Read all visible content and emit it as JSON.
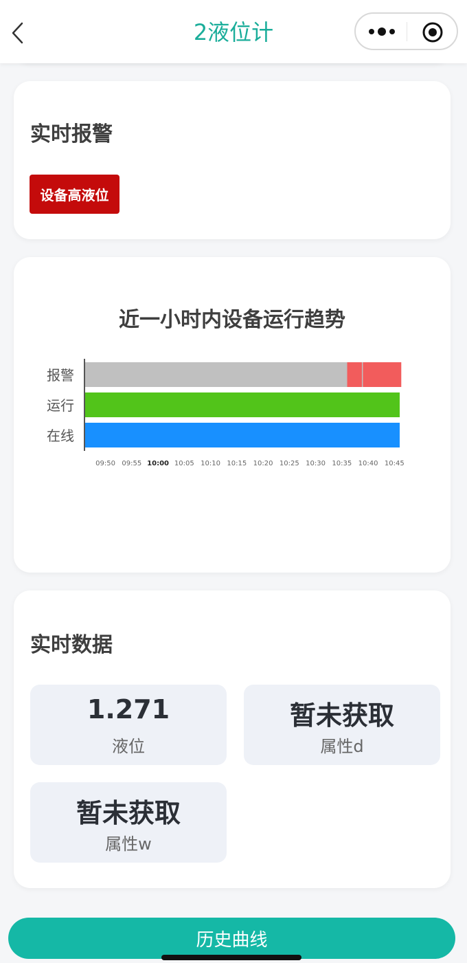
{
  "nav": {
    "title": "2液位计",
    "back_icon": "chevron-left-icon",
    "more_icon": "more-dots-icon",
    "close_icon": "target-circle-icon"
  },
  "alarm_section": {
    "title": "实时报警",
    "badges": [
      "设备高液位"
    ],
    "badge_color": "#c40b0b"
  },
  "trend_section": {
    "chart_data": {
      "type": "timeline",
      "title": "近一小时内设备运行趋势",
      "categories": [
        "报警",
        "运行",
        "在线"
      ],
      "x_ticks": [
        "09:50",
        "09:55",
        "10:00",
        "10:05",
        "10:10",
        "10:15",
        "10:20",
        "10:25",
        "10:30",
        "10:35",
        "10:40",
        "10:45"
      ],
      "bold_tick": "10:00",
      "x_range": [
        "09:46",
        "10:46"
      ],
      "colors": {
        "报警_base": "#c0c0c0",
        "报警_event": "#f25c5c",
        "运行": "#52c41a",
        "在线": "#1890ff"
      },
      "series": [
        {
          "name": "报警",
          "base_state": "normal",
          "events": [
            {
              "time": "10:36",
              "duration_min": 0.2
            },
            {
              "time": "10:37",
              "duration_min": 0.3
            },
            {
              "time": "10:39",
              "duration_min": 0.3
            },
            {
              "time": "10:40",
              "duration_min": 0.3
            },
            {
              "time": "10:41",
              "duration_min": 0.2
            },
            {
              "time": "10:41.5",
              "duration_min": 0.2
            },
            {
              "time": "10:42",
              "duration_min": 0.2
            },
            {
              "time": "10:43",
              "duration_min": 0.3
            },
            {
              "time": "10:44",
              "duration_min": 0.3
            },
            {
              "time": "10:44.5",
              "duration_min": 0.3
            }
          ]
        },
        {
          "name": "运行",
          "segments": [
            {
              "start": "09:46",
              "end": "10:46"
            }
          ]
        },
        {
          "name": "在线",
          "segments": [
            {
              "start": "09:46",
              "end": "10:46"
            }
          ]
        }
      ]
    }
  },
  "data_section": {
    "title": "实时数据",
    "tiles": [
      {
        "value": "1.271",
        "label": "液位"
      },
      {
        "value": "暂未获取",
        "label": "属性d"
      },
      {
        "value": "暂未获取",
        "label": "属性w"
      }
    ]
  },
  "history_button": {
    "label": "历史曲线",
    "color": "#15b8a6"
  }
}
